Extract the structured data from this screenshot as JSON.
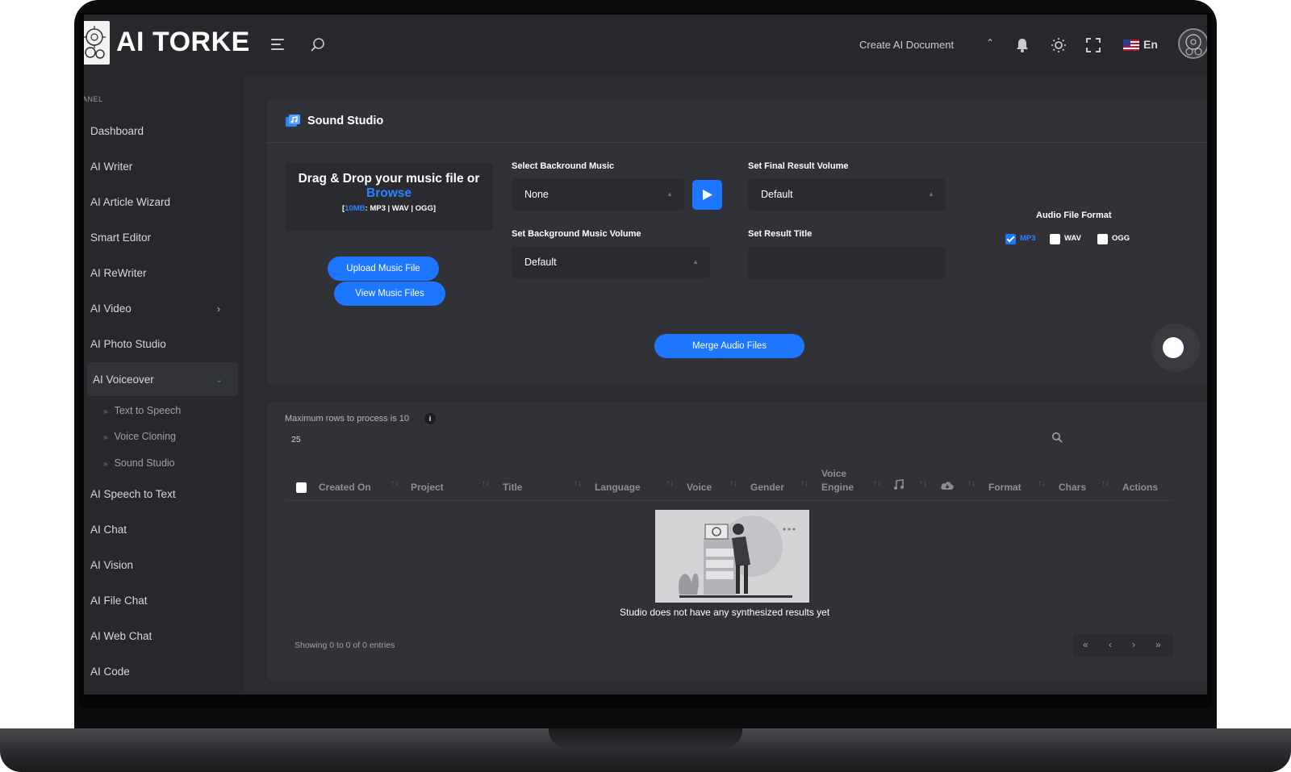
{
  "header": {
    "logo_text": "AI TORKE",
    "create_document": "Create AI Document",
    "language": "En",
    "icons": [
      "hamburger-icon",
      "search-icon",
      "caret-up-icon",
      "bell-icon",
      "sun-icon",
      "fullscreen-icon",
      "us-flag-icon",
      "avatar"
    ]
  },
  "sidebar": {
    "panel_label": "ANEL",
    "items": [
      {
        "label": "Dashboard"
      },
      {
        "label": "AI Writer"
      },
      {
        "label": "AI Article Wizard"
      },
      {
        "label": "Smart Editor"
      },
      {
        "label": "AI ReWriter"
      },
      {
        "label": "AI Video"
      },
      {
        "label": "AI Photo Studio"
      },
      {
        "label": "AI Voiceover"
      },
      {
        "label": "AI Speech to Text"
      },
      {
        "label": "AI Chat"
      },
      {
        "label": "AI Vision"
      },
      {
        "label": "AI File Chat"
      },
      {
        "label": "AI Web Chat"
      },
      {
        "label": "AI Code"
      }
    ],
    "sub_items": [
      {
        "label": "Text to Speech"
      },
      {
        "label": "Voice Cloning"
      },
      {
        "label": "Sound Studio"
      }
    ],
    "active_item": "AI Voiceover"
  },
  "studio": {
    "title": "Sound Studio",
    "drop_line1": "Drag & Drop your music file or",
    "drop_browse": "Browse",
    "drop_limit": "10MB",
    "drop_formats": ": MP3 | WAV | OGG",
    "upload_button": "Upload Music File",
    "view_button": "View Music Files",
    "merge_button": "Merge Audio Files",
    "bg_music_label": "Select Backround Music",
    "bg_music_value": "None",
    "bg_volume_label": "Set Background Music Volume",
    "bg_volume_value": "Default",
    "final_volume_label": "Set Final Result Volume",
    "final_volume_value": "Default",
    "result_title_label": "Set Result Title",
    "result_title_value": "",
    "format_label": "Audio File Format",
    "formats": [
      {
        "label": "MP3",
        "checked": true
      },
      {
        "label": "WAV",
        "checked": false
      },
      {
        "label": "OGG",
        "checked": false
      }
    ]
  },
  "table": {
    "max_rows_text": "Maximum rows to process is 10",
    "rows_per_page": "25",
    "columns": [
      "Created On",
      "Project",
      "Title",
      "Language",
      "Voice",
      "Gender",
      "Voice",
      "Engine",
      "Format",
      "Chars",
      "Actions"
    ],
    "empty_text": "Studio does not have any synthesized results yet",
    "showing_text": "Showing 0 to 0 of 0 entries",
    "pager": [
      "«",
      "‹",
      "›",
      "»"
    ]
  },
  "colors": {
    "accent": "#1d76ff",
    "background": "#2b2c30",
    "card": "#313237",
    "sidebar": "#27282c"
  }
}
